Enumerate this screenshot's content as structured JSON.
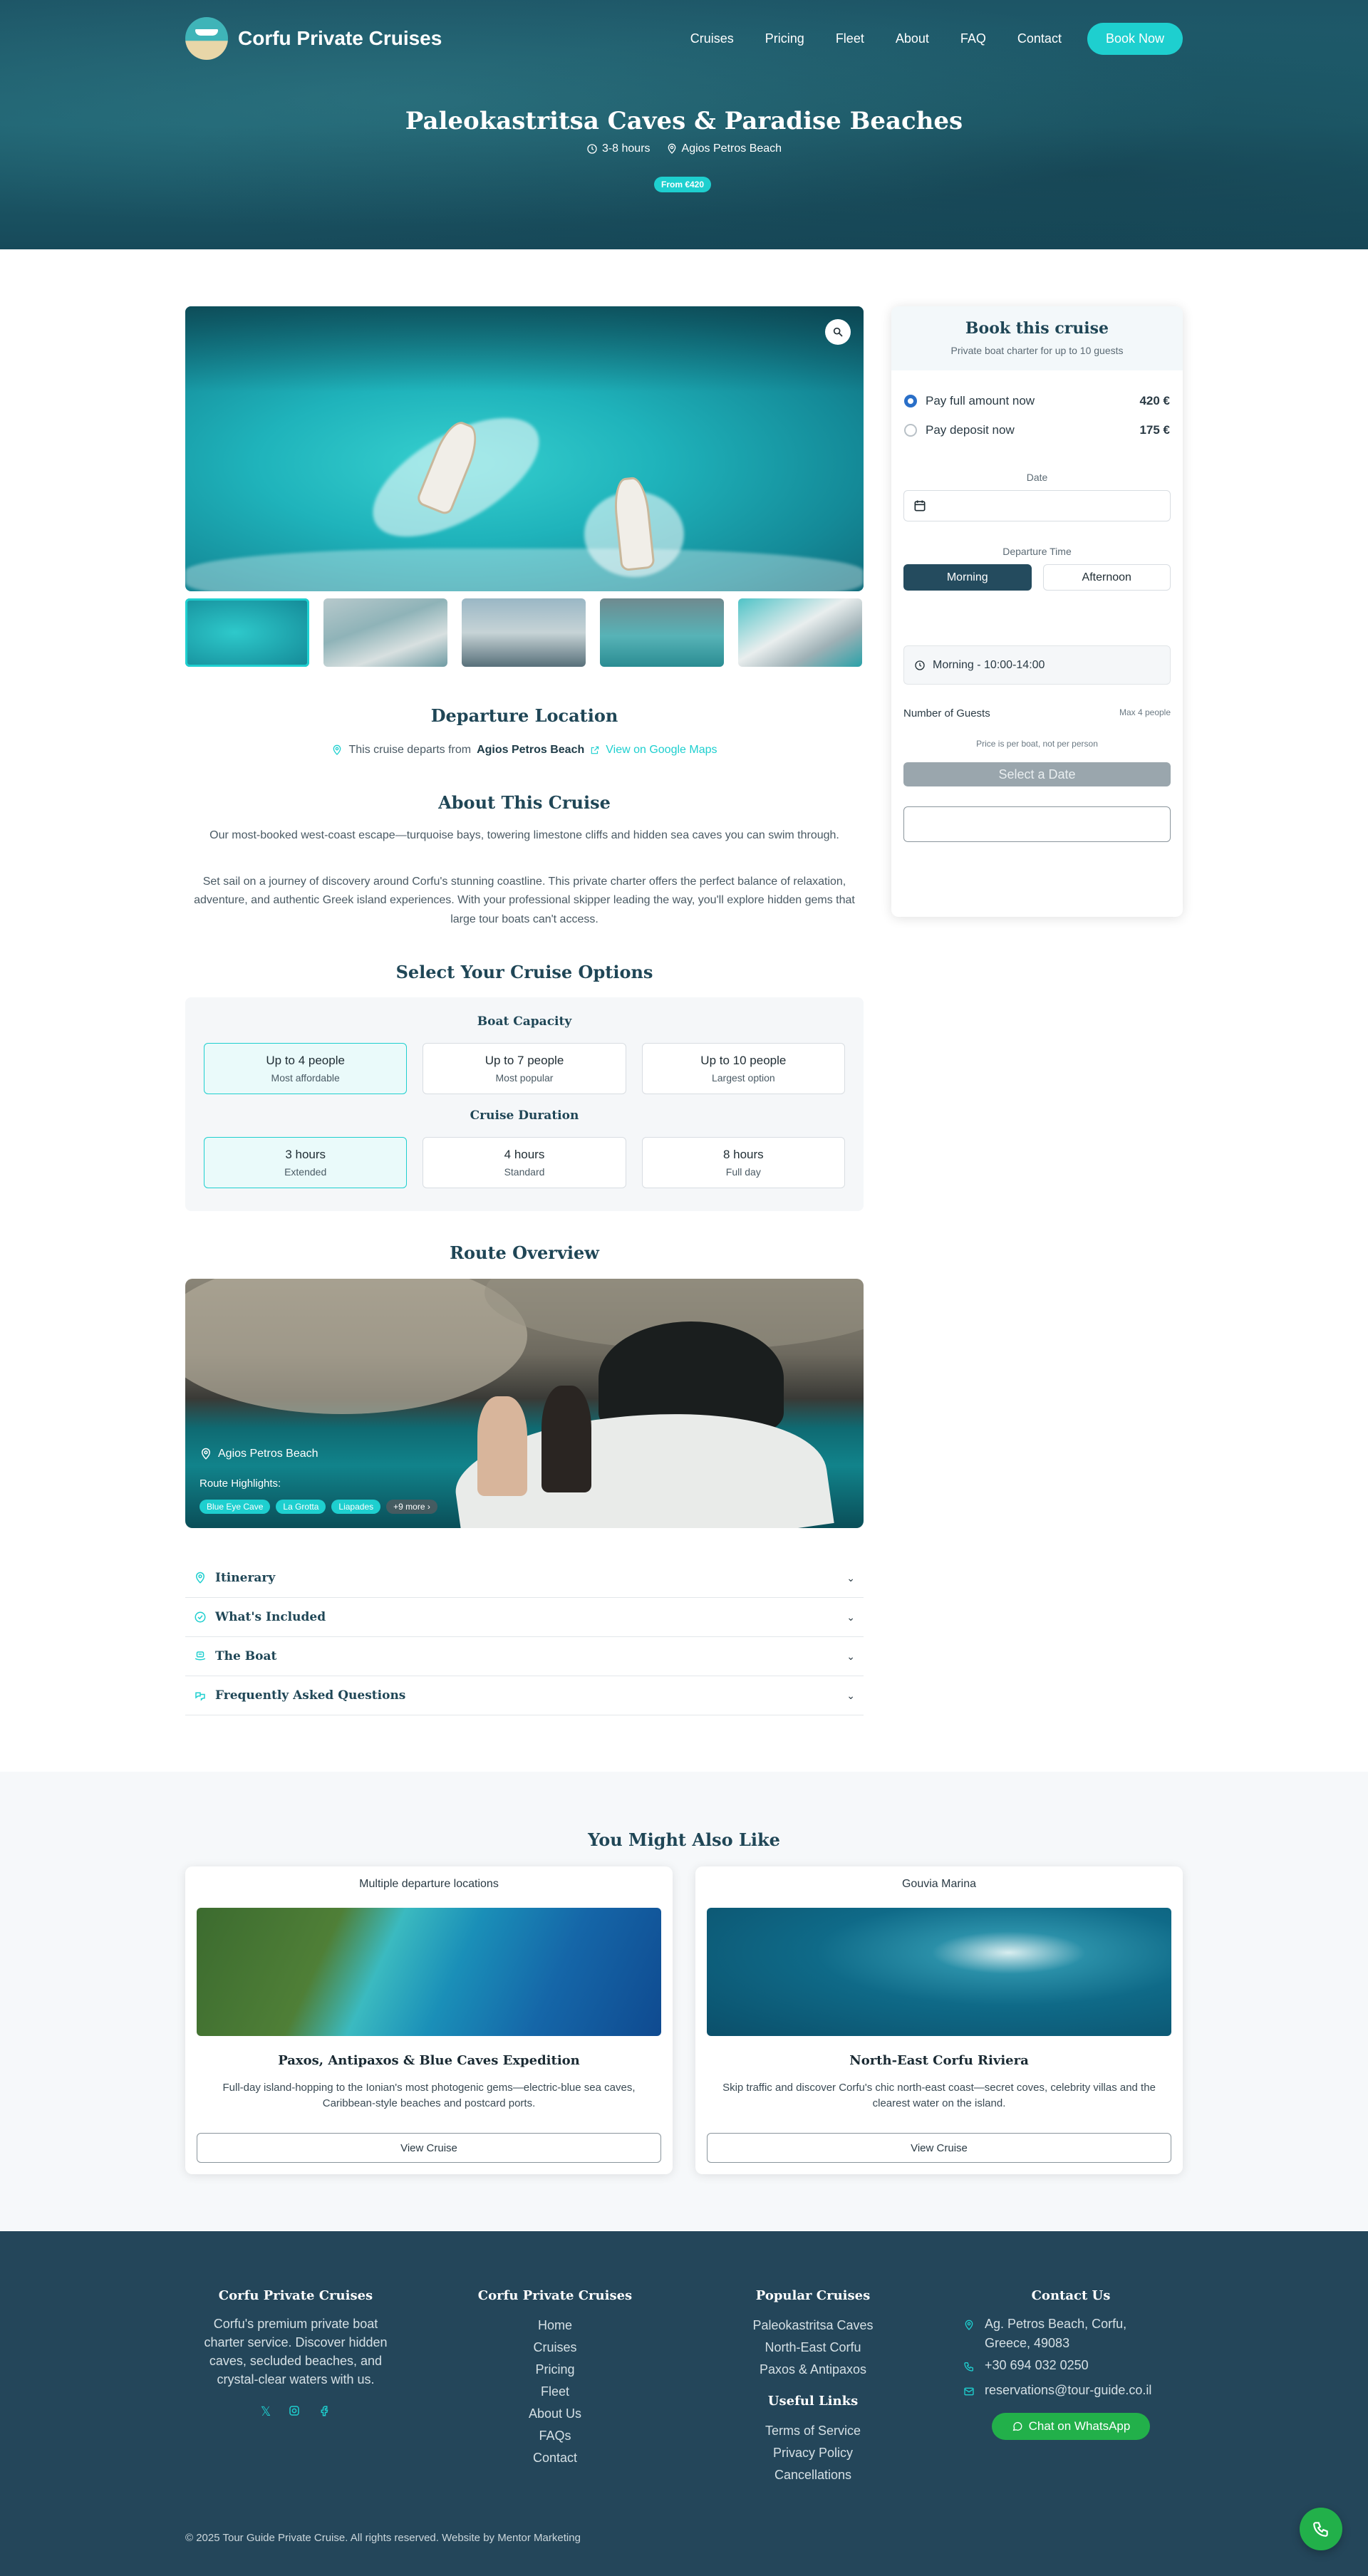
{
  "nav": {
    "brand": "Corfu Private Cruises",
    "links": [
      "Cruises",
      "Pricing",
      "Fleet",
      "About",
      "FAQ",
      "Contact"
    ],
    "cta": "Book Now"
  },
  "hero": {
    "title": "Paleokastritsa Caves & Paradise Beaches",
    "duration": "3-8 hours",
    "location": "Agios Petros Beach",
    "price_badge": "From €420"
  },
  "departure": {
    "title": "Departure Location",
    "prefix": "This cruise departs from",
    "place": "Agios Petros Beach",
    "map_link": "View on Google Maps"
  },
  "about": {
    "title": "About This Cruise",
    "p1": "Our most-booked west-coast escape—turquoise bays, towering limestone cliffs and hidden sea caves you can swim through.",
    "p2": "Set sail on a journey of discovery around Corfu's stunning coastline. This private charter offers the perfect balance of relaxation, adventure, and authentic Greek island experiences. With your professional skipper leading the way, you'll explore hidden gems that large tour boats can't access."
  },
  "options": {
    "title": "Select Your Cruise Options",
    "capacity_title": "Boat Capacity",
    "capacity": [
      {
        "title": "Up to 4 people",
        "sub": "Most affordable"
      },
      {
        "title": "Up to 7 people",
        "sub": "Most popular"
      },
      {
        "title": "Up to 10 people",
        "sub": "Largest option"
      }
    ],
    "duration_title": "Cruise Duration",
    "duration": [
      {
        "title": "3 hours",
        "sub": "Extended"
      },
      {
        "title": "4 hours",
        "sub": "Standard"
      },
      {
        "title": "8 hours",
        "sub": "Full day"
      }
    ]
  },
  "route": {
    "title": "Route Overview",
    "location": "Agios Petros Beach",
    "highlights_label": "Route Highlights:",
    "tags": [
      "Blue Eye Cave",
      "La Grotta",
      "Liapades",
      "+9 more"
    ]
  },
  "accordion": [
    "Itinerary",
    "What's Included",
    "The Boat",
    "Frequently Asked Questions"
  ],
  "booking": {
    "title": "Book this cruise",
    "subtitle": "Private boat charter for up to 10 guests",
    "pay_full": "Pay full amount now",
    "pay_full_amount": "420 €",
    "pay_deposit": "Pay deposit now",
    "pay_deposit_amount": "175 €",
    "date_label": "Date",
    "time_label": "Departure Time",
    "morning": "Morning",
    "afternoon": "Afternoon",
    "slot": "Morning - 10:00-14:00",
    "guests_label": "Number of Guests",
    "guests_max": "Max 4 people",
    "per_boat": "Price is per boat, not per person",
    "select_btn": "Select a Date"
  },
  "related": {
    "title": "You Might Also Like",
    "cards": [
      {
        "location": "Multiple departure locations",
        "title": "Paxos, Antipaxos & Blue Caves Expedition",
        "desc": "Full-day island-hopping to the Ionian's most photogenic gems—electric-blue sea caves, Caribbean-style beaches and postcard ports.",
        "button": "View Cruise"
      },
      {
        "location": "Gouvia Marina",
        "title": "North-East Corfu Riviera",
        "desc": "Skip traffic and discover Corfu's chic north-east coast—secret coves, celebrity villas and the clearest water on the island.",
        "button": "View Cruise"
      }
    ]
  },
  "footer": {
    "about_title": "Corfu Private Cruises",
    "about_text": "Corfu's premium private boat charter service. Discover hidden caves, secluded beaches, and crystal-clear waters with us.",
    "nav_title": "Corfu Private Cruises",
    "nav_links": [
      "Home",
      "Cruises",
      "Pricing",
      "Fleet",
      "About Us",
      "FAQs",
      "Contact"
    ],
    "popular_title": "Popular Cruises",
    "popular_links": [
      "Paleokastritsa Caves",
      "North-East Corfu",
      "Paxos & Antipaxos"
    ],
    "useful_title": "Useful Links",
    "useful_links": [
      "Terms of Service",
      "Privacy Policy",
      "Cancellations"
    ],
    "contact_title": "Contact Us",
    "address": "Ag. Petros Beach, Corfu, Greece, 49083",
    "phone": "+30 694 032 0250",
    "email": "reservations@tour-guide.co.il",
    "whatsapp": "Chat on WhatsApp",
    "copyright": "© 2025 Tour Guide Private Cruise. All rights reserved. Website by Mentor Marketing"
  },
  "colors": {
    "accent": "#1ecfcf",
    "dark": "#24465a",
    "whatsapp": "#22b04a"
  }
}
